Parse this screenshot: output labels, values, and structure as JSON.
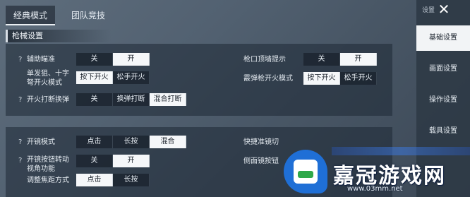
{
  "tabs": [
    {
      "label": "经典模式",
      "active": true
    },
    {
      "label": "团队竞技",
      "active": false
    }
  ],
  "section_title": "枪械设置",
  "panel1": {
    "rows": [
      {
        "label": "辅助瞄准",
        "has_help": true,
        "options": [
          "关",
          "开"
        ],
        "selected": 1
      },
      {
        "label": "单发狙、十字弩开火模式",
        "has_help": false,
        "options": [
          "按下开火",
          "松手开火"
        ],
        "selected": 0
      },
      {
        "label": "开火打断换弹",
        "has_help": true,
        "options": [
          "关",
          "换弹打断",
          "混合打断"
        ],
        "selected": 2
      }
    ],
    "right_rows": [
      {
        "label": "枪口顶墙提示",
        "options": [
          "关",
          "开"
        ],
        "selected": 1
      },
      {
        "label": "霰弹枪开火模式",
        "options": [
          "按下开火",
          "松手开火"
        ],
        "selected": 0
      }
    ]
  },
  "panel2": {
    "rows": [
      {
        "label": "开镜模式",
        "has_help": true,
        "options": [
          "点击",
          "长按",
          "混合"
        ],
        "selected": 2
      },
      {
        "label": "开镜按钮转动视角功能",
        "has_help": true,
        "options": [
          "关",
          "开"
        ],
        "selected": 1
      },
      {
        "label": "调整焦距方式",
        "has_help": false,
        "options": [
          "点击",
          "长按"
        ],
        "selected": 0
      }
    ],
    "right_rows": [
      {
        "label": "快捷准镜切"
      },
      {
        "label": "侧面镜按钮"
      }
    ]
  },
  "sidebar": {
    "header": "设置",
    "items": [
      {
        "label": "基础设置",
        "active": true
      },
      {
        "label": "画面设置",
        "active": false
      },
      {
        "label": "操作设置",
        "active": false
      },
      {
        "label": "载具设置",
        "active": false
      }
    ]
  },
  "watermark": {
    "name": "嘉冠游戏网",
    "url": "www.03mm.net"
  },
  "icons": {
    "help": "question-mark-icon",
    "close": "close-icon",
    "logo": "site-logo-icon"
  }
}
